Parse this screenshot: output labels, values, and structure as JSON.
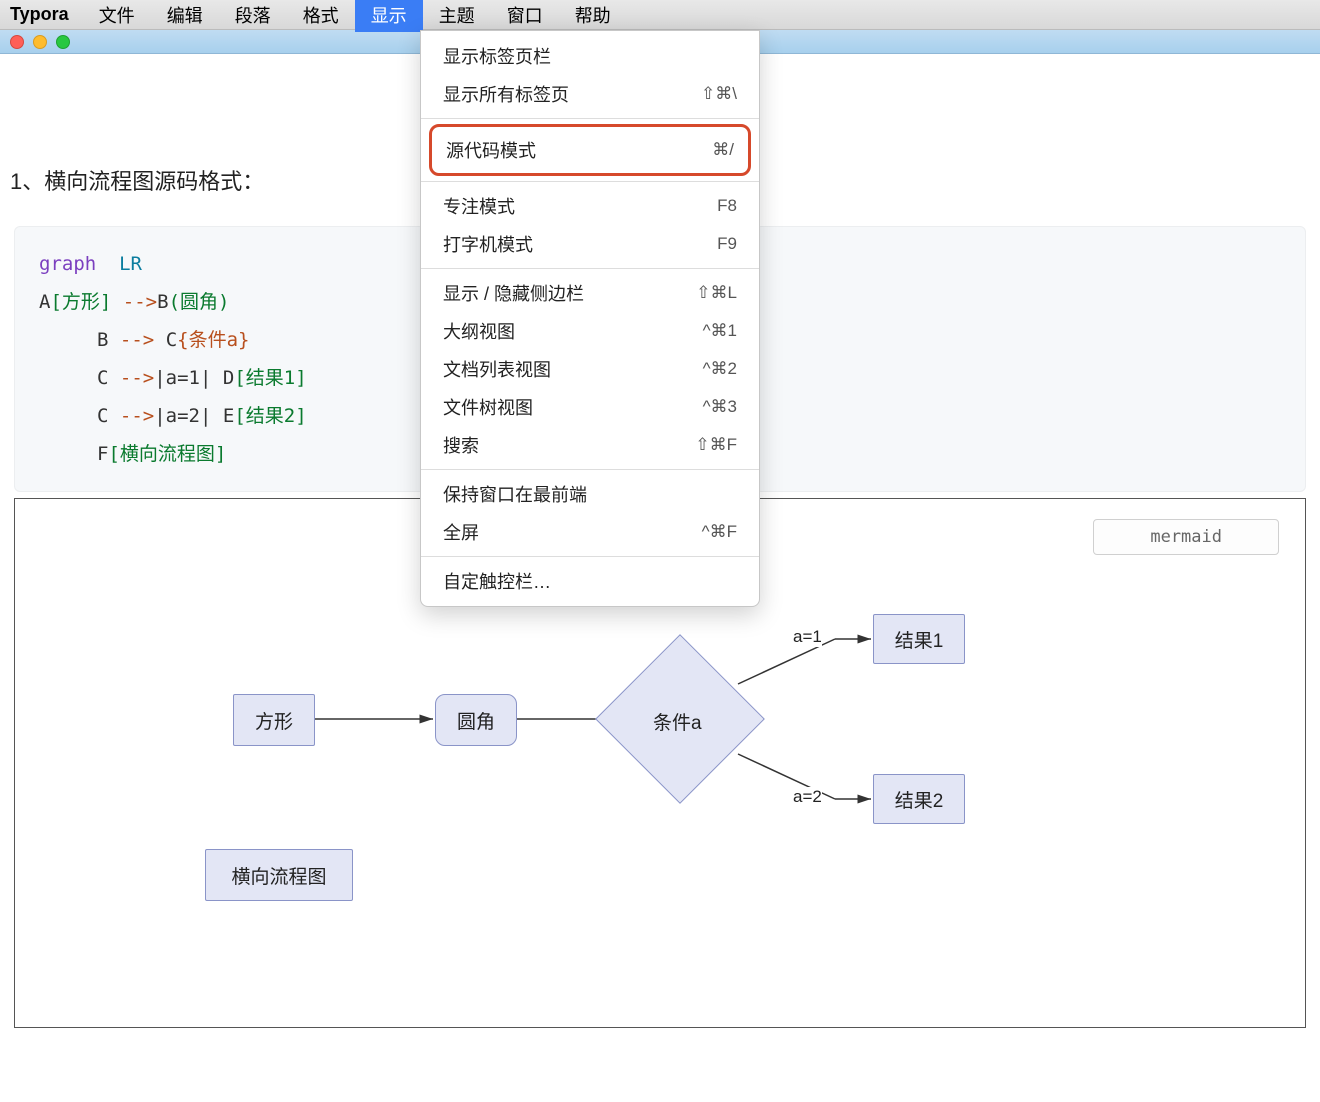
{
  "menubar": {
    "app": "Typora",
    "items": [
      "文件",
      "编辑",
      "段落",
      "格式",
      "显示",
      "主题",
      "窗口",
      "帮助"
    ],
    "activeIndex": 4
  },
  "dropdown": {
    "groups": [
      [
        {
          "label": "显示标签页栏",
          "shortcut": ""
        },
        {
          "label": "显示所有标签页",
          "shortcut": "⇧⌘\\"
        }
      ],
      [
        {
          "label": "源代码模式",
          "shortcut": "⌘/",
          "highlighted": true
        }
      ],
      [
        {
          "label": "专注模式",
          "shortcut": "F8"
        },
        {
          "label": "打字机模式",
          "shortcut": "F9"
        }
      ],
      [
        {
          "label": "显示 / 隐藏侧边栏",
          "shortcut": "⇧⌘L"
        },
        {
          "label": "大纲视图",
          "shortcut": "^⌘1"
        },
        {
          "label": "文档列表视图",
          "shortcut": "^⌘2"
        },
        {
          "label": "文件树视图",
          "shortcut": "^⌘3"
        },
        {
          "label": "搜索",
          "shortcut": "⇧⌘F"
        }
      ],
      [
        {
          "label": "保持窗口在最前端",
          "shortcut": ""
        },
        {
          "label": "全屏",
          "shortcut": "^⌘F"
        }
      ],
      [
        {
          "label": "自定触控栏…",
          "shortcut": ""
        }
      ]
    ]
  },
  "content": {
    "heading": "1、横向流程图源码格式：",
    "code": {
      "line1_kw": "graph",
      "line1_id": "LR",
      "line2_a": "A",
      "line2_sq": "[方形]",
      "line2_op": "-->",
      "line2_b": "B",
      "line2_rd": "(圆角)",
      "line3_b": "B",
      "line3_op": "-->",
      "line3_c": "C",
      "line3_di": "{条件a}",
      "line4_c": "C",
      "line4_op": "-->",
      "line4_edge": "|a=1|",
      "line4_d": "D",
      "line4_sq": "[结果1]",
      "line5_c": "C",
      "line5_op": "-->",
      "line5_edge": "|a=2|",
      "line5_e": "E",
      "line5_sq": "[结果2]",
      "line6_f": "F",
      "line6_sq": "[横向流程图]"
    },
    "diagram": {
      "language": "mermaid",
      "nodes": {
        "A": "方形",
        "B": "圆角",
        "C": "条件a",
        "D": "结果1",
        "E": "结果2",
        "F": "横向流程图"
      },
      "edges": {
        "e1": "a=1",
        "e2": "a=2"
      }
    }
  },
  "chart_data": {
    "type": "diagram",
    "direction": "LR",
    "nodes": [
      {
        "id": "A",
        "label": "方形",
        "shape": "rect"
      },
      {
        "id": "B",
        "label": "圆角",
        "shape": "round"
      },
      {
        "id": "C",
        "label": "条件a",
        "shape": "diamond"
      },
      {
        "id": "D",
        "label": "结果1",
        "shape": "rect"
      },
      {
        "id": "E",
        "label": "结果2",
        "shape": "rect"
      },
      {
        "id": "F",
        "label": "横向流程图",
        "shape": "rect"
      }
    ],
    "edges": [
      {
        "from": "A",
        "to": "B"
      },
      {
        "from": "B",
        "to": "C"
      },
      {
        "from": "C",
        "to": "D",
        "label": "a=1"
      },
      {
        "from": "C",
        "to": "E",
        "label": "a=2"
      }
    ]
  }
}
